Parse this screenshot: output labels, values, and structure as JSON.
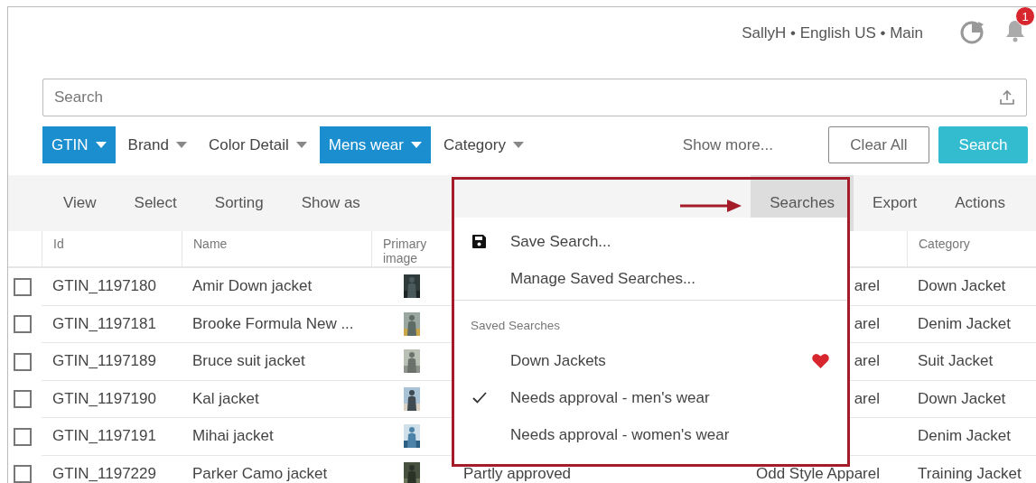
{
  "header": {
    "user_info": "SallyH • English US • Main",
    "notification_count": "1"
  },
  "search": {
    "placeholder": "Search"
  },
  "filters": [
    {
      "label": "GTIN",
      "selected": true
    },
    {
      "label": "Brand",
      "selected": false
    },
    {
      "label": "Color Detail",
      "selected": false
    },
    {
      "label": "Mens wear",
      "selected": true
    },
    {
      "label": "Category",
      "selected": false
    }
  ],
  "show_more": "Show more...",
  "buttons": [
    {
      "kind": "outline",
      "label": "Clear All"
    },
    {
      "kind": "primary",
      "label": "Search"
    }
  ],
  "toolbar": {
    "left": [
      {
        "label": "View",
        "selected": false
      },
      {
        "label": "Select",
        "selected": false
      },
      {
        "label": "Sorting",
        "selected": false
      },
      {
        "label": "Show as",
        "selected": false
      }
    ],
    "right": [
      {
        "label": "Searches",
        "selected": true
      },
      {
        "label": "Export",
        "selected": false
      },
      {
        "label": "Actions",
        "selected": false
      }
    ]
  },
  "table": {
    "columns": [
      "Id",
      "Name",
      "Primary image",
      "Category"
    ],
    "rows": [
      {
        "checked": false,
        "id": "GTIN_1197180",
        "name": "Amir Down jacket",
        "column_5": "arel",
        "category": "Down Jacket"
      },
      {
        "checked": false,
        "id": "GTIN_1197181",
        "name": "Brooke Formula New ...",
        "column_5": "arel",
        "category": "Denim Jacket"
      },
      {
        "checked": false,
        "id": "GTIN_1197189",
        "name": "Bruce suit jacket",
        "column_5": "arel",
        "category": "Suit Jacket"
      },
      {
        "checked": false,
        "id": "GTIN_1197190",
        "name": "Kal jacket",
        "column_5": "arel",
        "category": "Down Jacket"
      },
      {
        "checked": false,
        "id": "GTIN_1197191",
        "name": "Mihai jacket",
        "category": "Denim Jacket"
      },
      {
        "checked": false,
        "id": "GTIN_1197229",
        "name": "Parker Camo jacket",
        "column_4": "Partly approved",
        "column_5": "Odd Style Apparel",
        "category": "Training Jacket"
      }
    ]
  },
  "searches_menu": {
    "actions": [
      {
        "kind": "save",
        "label": "Save Search..."
      },
      {
        "kind": "plain",
        "label": "Manage Saved Searches..."
      }
    ],
    "saved_heading": "Saved Searches",
    "saved": [
      {
        "label": "Down Jackets",
        "checked": false,
        "favorite": true
      },
      {
        "label": "Needs approval - men's wear",
        "checked": true,
        "favorite": false
      },
      {
        "label": "Needs approval - women's wear",
        "checked": false,
        "favorite": false
      }
    ]
  }
}
